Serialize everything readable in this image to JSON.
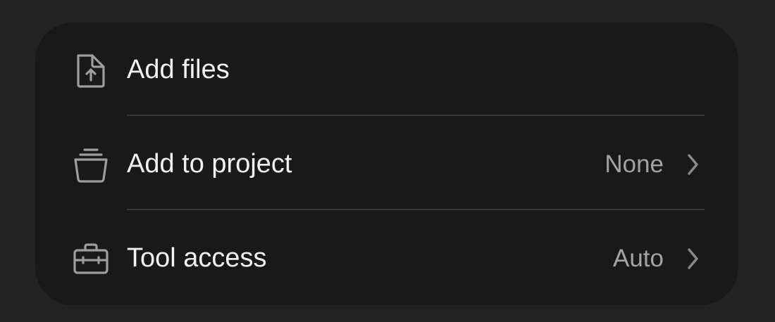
{
  "menu": {
    "add_files": {
      "label": "Add files",
      "icon": "file-upload-icon"
    },
    "add_to_project": {
      "label": "Add to project",
      "value": "None",
      "icon": "project-stack-icon"
    },
    "tool_access": {
      "label": "Tool access",
      "value": "Auto",
      "icon": "toolbox-icon"
    }
  },
  "colors": {
    "page_background": "#232323",
    "card_background": "#191919",
    "label_text": "#f2f2f2",
    "value_text": "#a3a3a3",
    "divider": "#3a3a3a"
  }
}
